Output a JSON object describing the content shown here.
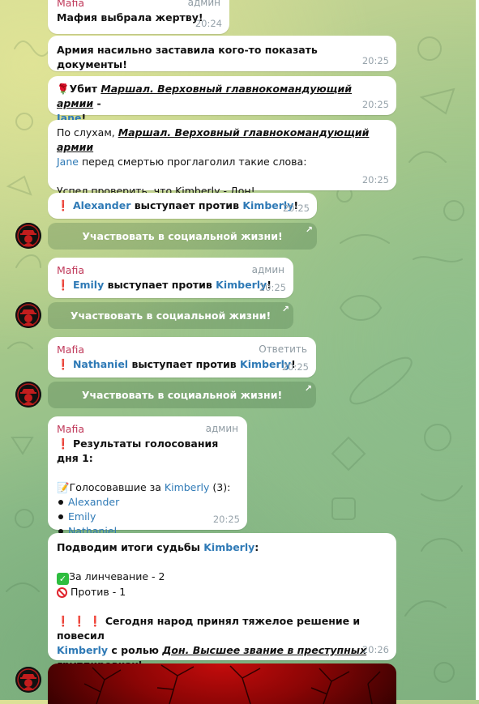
{
  "chat": {
    "m1": {
      "sender": "Mafia",
      "tag": "админ",
      "text": "Мафия выбрала жертву!",
      "time": "20:24"
    },
    "m2": {
      "text": "Армия насильно заставила кого-то показать документы!",
      "time": "20:25"
    },
    "m3": {
      "icon": "rose-icon",
      "prefix": "Убит ",
      "role": "Маршал. Верховный главнокомандующий армии",
      "sep": " - ",
      "name": "Jane",
      "suffix": "!",
      "time": "20:25"
    },
    "m4": {
      "prefix": "По слухам, ",
      "role": "Маршал. Верховный главнокомандующий армии",
      "name": "Jane",
      "rest": " перед смертью проглаголил такие слова:",
      "quote": "Успел проверить, что Kimberly - Дон!",
      "time": "20:25"
    },
    "m5": {
      "icon": "exclamation-icon",
      "actor": "Alexander",
      "verb": " выступает против ",
      "target": "Kimberly",
      "end": "!",
      "time": "20:25"
    },
    "btn1": {
      "label": "Участвовать в социальной жизни!"
    },
    "m6": {
      "sender": "Mafia",
      "tag": "админ",
      "actor": "Emily",
      "verb": " выступает против ",
      "target": "Kimberly",
      "end": "!",
      "time": "20:25"
    },
    "btn2": {
      "label": "Участвовать в социальной жизни!"
    },
    "m7": {
      "sender": "Mafia",
      "tag": "Ответить",
      "actor": "Nathaniel",
      "verb": " выступает против ",
      "target": "Kimberly",
      "end": "!",
      "time": "20:25"
    },
    "btn3": {
      "label": "Участвовать в социальной жизни!"
    },
    "m8": {
      "sender": "Mafia",
      "tag": "админ",
      "title": "Результаты голосования дня 1:",
      "votes_prefix": "Голосовавшие за ",
      "votes_target": "Kimberly",
      "votes_count": " (3):",
      "voters": [
        "Alexander",
        "Emily",
        "Nathaniel"
      ],
      "time": "20:25"
    },
    "m9": {
      "title_prefix": "Подводим итоги судьбы ",
      "title_name": "Kimberly",
      "title_end": ":",
      "yes": "За линчевание - 2",
      "no": "Против - 1",
      "verdict": "Сегодня народ принял тяжелое решение и повесил",
      "verdict_name": "Kimberly",
      "verdict_mid": " с ролью ",
      "verdict_role": "Дон. Высшее звание в преступных группировках",
      "verdict_end": "!",
      "time": "20:26"
    }
  },
  "colors": {
    "link": "#2f7ab6",
    "sender": "#c03a5b",
    "bubble": "#ffffff"
  }
}
